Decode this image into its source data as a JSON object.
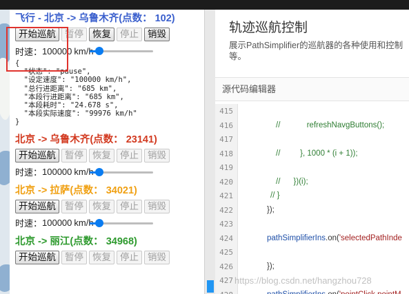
{
  "routes": [
    {
      "title": "飞行 - 北京 -> 乌鲁木齐(点数： 102)",
      "title_color": "#3a5fcd",
      "buttons": [
        "开始巡航",
        "暂停",
        "恢复",
        "停止",
        "销毁"
      ],
      "speed_label": "时速：",
      "speed_value": "100000",
      "speed_unit": "km/h",
      "slider_level": 0.1,
      "status_lines": [
        "{",
        "  \"状态\": \"pause\",",
        "  \"设定速度\": \"100000 km/h\",",
        "  \"总行进距离\": \"685 km\",",
        "  \"本段行进距离\": \"685 km\",",
        "  \"本段耗时\": \"24.678 s\",",
        "  \"本段实际速度\": \"99976 km/h\"",
        "}"
      ]
    },
    {
      "title": "北京 -> 乌鲁木齐(点数：  23141)",
      "title_color": "#d2391f",
      "buttons": [
        "开始巡航",
        "暂停",
        "恢复",
        "停止",
        "销毁"
      ],
      "speed_label": "时速：",
      "speed_value": "100000",
      "speed_unit": "km/h",
      "slider_level": 0.1
    },
    {
      "title": "北京 -> 拉萨(点数：  34021)",
      "title_color": "#f0a012",
      "buttons": [
        "开始巡航",
        "暂停",
        "恢复",
        "停止",
        "销毁"
      ],
      "speed_label": "时速：",
      "speed_value": "100000",
      "speed_unit": "km/h",
      "slider_level": 0.1
    },
    {
      "title": "北京 -> 丽江(点数：  34968)",
      "title_color": "#2e9a2e",
      "buttons": [
        "开始巡航",
        "暂停",
        "恢复",
        "停止",
        "销毁"
      ]
    }
  ],
  "demo": {
    "title": "轨迹巡航控制",
    "description": "展示PathSimplifier的巡航器的各种使用和控制\n等。",
    "editor_label": "源代码编辑器"
  },
  "code_lines": [
    {
      "n": "415",
      "parts": [
        {
          "t": "",
          "c": "punct"
        }
      ]
    },
    {
      "n": "416",
      "parts": [
        {
          "t": "//            refreshNavgButtons();",
          "c": "comment"
        }
      ]
    },
    {
      "n": "417",
      "parts": [
        {
          "t": "",
          "c": "punct"
        }
      ]
    },
    {
      "n": "418",
      "parts": [
        {
          "t": "//         }, 1000 * (i + 1));",
          "c": "comment"
        }
      ]
    },
    {
      "n": "419",
      "parts": [
        {
          "t": "",
          "c": "punct"
        }
      ]
    },
    {
      "n": "420",
      "parts": [
        {
          "t": "//      })(i);",
          "c": "comment"
        }
      ]
    },
    {
      "n": "421",
      "parts": [
        {
          "t": "// }",
          "c": "comment"
        }
      ]
    },
    {
      "n": "422",
      "parts": [
        {
          "t": "});",
          "c": "punct"
        }
      ]
    },
    {
      "n": "423",
      "parts": [
        {
          "t": "",
          "c": "punct"
        }
      ]
    },
    {
      "n": "424",
      "parts": [
        {
          "t": "pathSimplifierIns",
          "c": "ident"
        },
        {
          "t": ".on(",
          "c": "punct"
        },
        {
          "t": "'selectedPathInde",
          "c": "str"
        }
      ]
    },
    {
      "n": "425",
      "parts": [
        {
          "t": "",
          "c": "punct"
        }
      ]
    },
    {
      "n": "426",
      "parts": [
        {
          "t": "});",
          "c": "punct"
        }
      ]
    },
    {
      "n": "427",
      "parts": [
        {
          "t": "",
          "c": "punct"
        }
      ]
    },
    {
      "n": "428",
      "parts": [
        {
          "t": "pathSimplifierIns",
          "c": "ident"
        },
        {
          "t": ".on(",
          "c": "punct"
        },
        {
          "t": "'pointClick pointM",
          "c": "str"
        }
      ]
    }
  ],
  "watermark": "https://blog.csdn.net/hangzhou728"
}
